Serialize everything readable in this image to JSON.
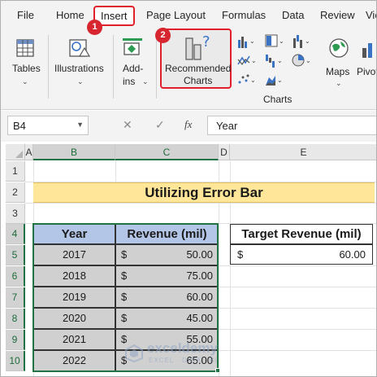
{
  "menu": {
    "tabs": [
      "File",
      "Home",
      "Insert",
      "Page Layout",
      "Formulas",
      "Data",
      "Review",
      "View"
    ],
    "active_tab": "Insert"
  },
  "callouts": [
    "1",
    "2"
  ],
  "ribbon": {
    "tables_label": "Tables",
    "illustrations_label": "Illustrations",
    "addins_label_line1": "Add-",
    "addins_label_line2": "ins",
    "recommended_line1": "Recommended",
    "recommended_line2": "Charts",
    "charts_group_label": "Charts",
    "maps_label": "Maps",
    "pivot_label": "Pivot"
  },
  "formula_bar": {
    "name_box": "B4",
    "fx": "fx",
    "value": "Year"
  },
  "sheet": {
    "columns": [
      "A",
      "B",
      "C",
      "D",
      "E"
    ],
    "selected_columns": [
      "B",
      "C"
    ],
    "rows": [
      "1",
      "2",
      "3",
      "4",
      "5",
      "6",
      "7",
      "8",
      "9",
      "10"
    ],
    "selected_rows": [
      "4",
      "5",
      "6",
      "7",
      "8",
      "9",
      "10"
    ],
    "title": "Utilizing Error Bar",
    "table": {
      "headers": [
        "Year",
        "Revenue (mil)"
      ],
      "rows": [
        {
          "year": "2017",
          "currency": "$",
          "revenue": "50.00"
        },
        {
          "year": "2018",
          "currency": "$",
          "revenue": "75.00"
        },
        {
          "year": "2019",
          "currency": "$",
          "revenue": "60.00"
        },
        {
          "year": "2020",
          "currency": "$",
          "revenue": "45.00"
        },
        {
          "year": "2021",
          "currency": "$",
          "revenue": "55.00"
        },
        {
          "year": "2022",
          "currency": "$",
          "revenue": "65.00"
        }
      ]
    },
    "target": {
      "header": "Target Revenue (mil)",
      "currency": "$",
      "value": "60.00"
    }
  },
  "watermark": {
    "name": "exceldemy",
    "tagline": "EXCEL · DATA · BI"
  },
  "colors": {
    "accent_red": "#e0202a",
    "excel_green": "#217346",
    "title_fill": "#ffe699",
    "header_fill": "#b4c6e7",
    "data_fill": "#d0d0d0"
  }
}
